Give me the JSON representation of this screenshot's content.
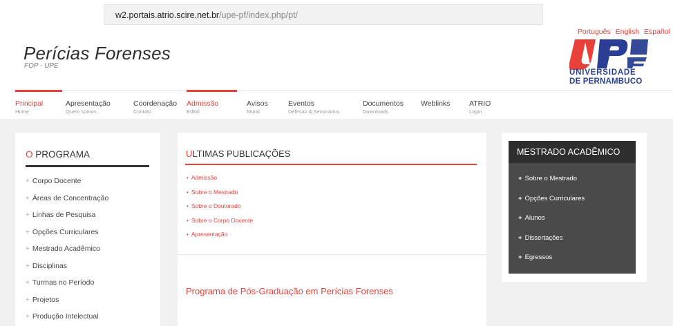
{
  "browser": {
    "url_host": "w2.portais.atrio.scire.net.br",
    "url_path": "/upe-pf/index.php/pt/"
  },
  "header": {
    "title": "Perícias Forenses",
    "subtitle": "FOP - UPE",
    "languages": [
      "Português",
      "English",
      "Español"
    ],
    "logo": {
      "mark": "UPE",
      "line1": "UNIVERSIDADE",
      "line2": "DE PERNAMBUCO",
      "colors": {
        "red": "#e8413a",
        "blue": "#2a3f93"
      }
    }
  },
  "nav": {
    "items": [
      {
        "label": "Principal",
        "sub": "Home",
        "active": true
      },
      {
        "label": "Apresentação",
        "sub": "Quem somos",
        "active": false
      },
      {
        "label": "Coordenação",
        "sub": "Contato",
        "active": false
      },
      {
        "label": "Admissão",
        "sub": "Edital",
        "active": true
      },
      {
        "label": "Avisos",
        "sub": "Mural",
        "active": false
      },
      {
        "label": "Eventos",
        "sub": "Defesas & Seminários",
        "active": false
      },
      {
        "label": "Documentos",
        "sub": "Downloads",
        "active": false
      },
      {
        "label": "Weblinks",
        "sub": "",
        "active": false
      },
      {
        "label": "ATRIO",
        "sub": "Login",
        "active": false
      }
    ]
  },
  "left_sidebar": {
    "title_first": "O",
    "title_rest": " PROGRAMA",
    "items": [
      "Corpo Docente",
      "Áreas de Concentração",
      "Linhas de Pesquisa",
      "Opções Curriculares",
      "Mestrado Acadêmico",
      "Disciplinas",
      "Turmas no Período",
      "Projetos",
      "Produção Intelectual"
    ]
  },
  "main": {
    "title_first": "U",
    "title_rest": "LTIMAS PUBLICAÇÕES",
    "links": [
      "Admissão",
      "Sobre o Mestrado",
      "Sobre o Doutorado",
      "Sobre o Corpo Docente",
      "Apresentação"
    ],
    "headline": "Programa de Pós-Graduação em Perícias Forenses"
  },
  "right_sidebar": {
    "title": "MESTRADO ACADÊMICO",
    "items": [
      "Sobre o Mestrado",
      "Opções Curriculares",
      "Alunos",
      "Dissertações",
      "Egressos"
    ]
  },
  "colors": {
    "accent": "#e8413a",
    "text": "#444444",
    "panel_dark": "#4a4a4a",
    "panel_header": "#2e2e2e",
    "page_bg": "#f1f1f1"
  }
}
